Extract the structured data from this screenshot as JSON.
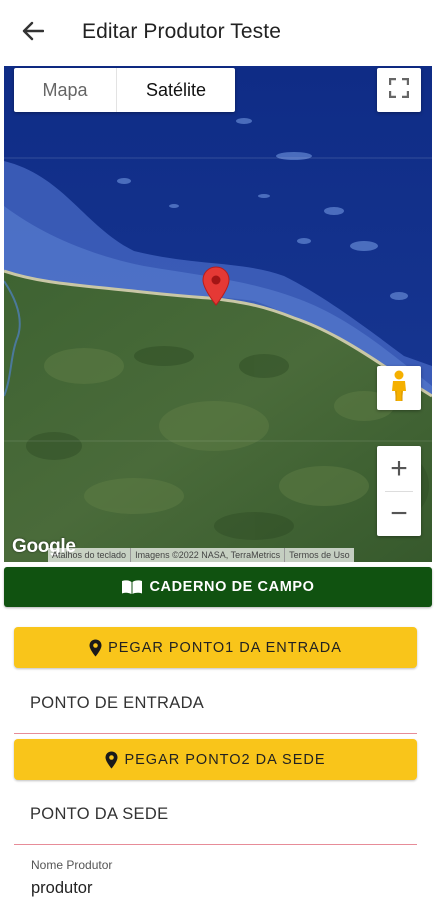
{
  "header": {
    "back_icon": "arrow-left-icon",
    "title": "Editar Produtor Teste"
  },
  "map": {
    "type_toggle": {
      "map_label": "Mapa",
      "satellite_label": "Satélite",
      "selected": "Satélite"
    },
    "controls": {
      "fullscreen_icon": "fullscreen-icon",
      "pegman_icon": "pegman-icon",
      "zoom_in": "+",
      "zoom_out": "−"
    },
    "marker_icon": "map-pin-icon",
    "google_logo": "Google",
    "attribution": [
      "Atalhos do teclado",
      "Imagens ©2022 NASA, TerraMetrics",
      "Termos de Uso"
    ],
    "colors": {
      "ocean": "#13308a",
      "marker": "#e53935"
    }
  },
  "actions": {
    "caderno": {
      "icon": "book-icon",
      "label": "CADERNO DE CAMPO"
    },
    "ponto1": {
      "icon": "location-pin-icon",
      "label": "PEGAR PONTO1 DA ENTRADA"
    },
    "ponto2": {
      "icon": "location-pin-icon",
      "label": "PEGAR PONTO2 DA SEDE"
    }
  },
  "fields": {
    "ponto_entrada": "PONTO DE ENTRADA",
    "ponto_sede": "PONTO DA SEDE",
    "nome_produtor": {
      "label": "Nome Produtor",
      "value": "produtor"
    }
  },
  "colors": {
    "primary_green": "#105210",
    "accent_yellow": "#f9c51a",
    "underline": "#e78c98"
  }
}
